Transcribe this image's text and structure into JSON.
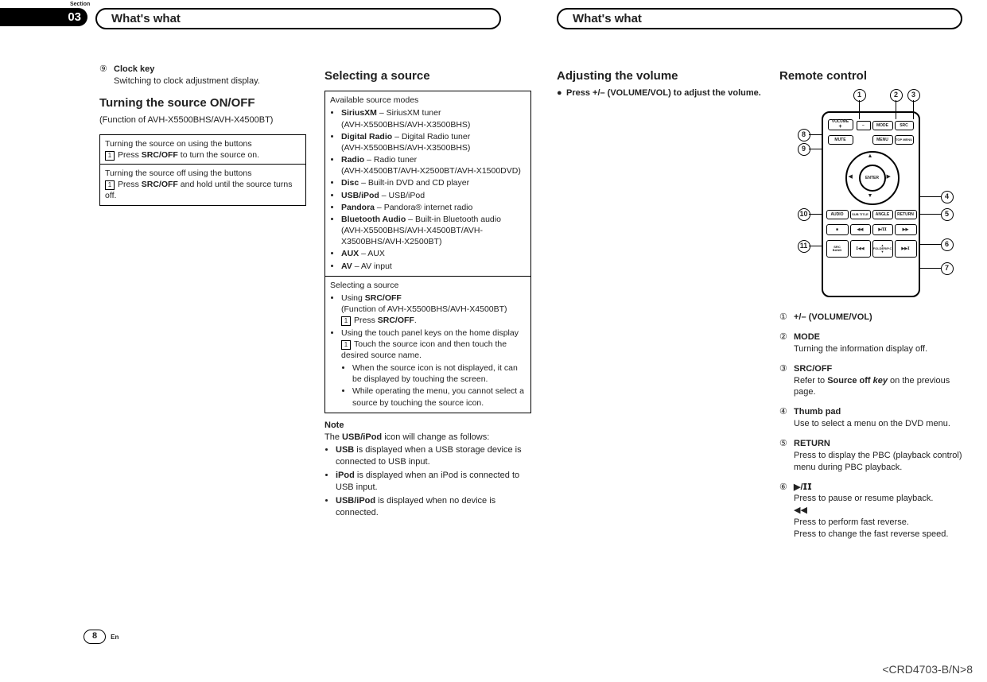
{
  "section": {
    "label": "Section",
    "number": "03"
  },
  "headers": {
    "left": "What's what",
    "right": "What's what"
  },
  "col1": {
    "item9": {
      "num": "⑨",
      "label": "Clock key",
      "desc": "Switching to clock adjustment display."
    },
    "h_turn": "Turning the source ON/OFF",
    "sub_turn": "(Function of AVH-X5500BHS/AVH-X4500BT)",
    "box_on": {
      "title": "Turning the source on using the buttons",
      "step_num": "1",
      "step_pre": "Press ",
      "step_bold": "SRC/OFF",
      "step_post": " to turn the source on."
    },
    "box_off": {
      "title": "Turning the source off using the buttons",
      "step_num": "1",
      "step_pre": "Press ",
      "step_bold": "SRC/OFF",
      "step_post": " and hold until the source turns off."
    }
  },
  "col2": {
    "h_select": "Selecting a source",
    "box_available": {
      "title": "Available source modes",
      "items": [
        {
          "name": "SiriusXM",
          "desc": " – SiriusXM tuner",
          "sub": "(AVH-X5500BHS/AVH-X3500BHS)"
        },
        {
          "name": "Digital Radio",
          "desc": " – Digital Radio tuner",
          "sub": "(AVH-X5500BHS/AVH-X3500BHS)"
        },
        {
          "name": "Radio",
          "desc": " – Radio tuner",
          "sub": "(AVH-X4500BT/AVH-X2500BT/AVH-X1500DVD)"
        },
        {
          "name": "Disc",
          "desc": " – Built-in DVD and CD player"
        },
        {
          "name": "USB/iPod",
          "desc": " – USB/iPod"
        },
        {
          "name": "Pandora",
          "desc": " – Pandora® internet radio"
        },
        {
          "name": "Bluetooth Audio",
          "desc": " – Built-in Bluetooth audio",
          "sub": "(AVH-X5500BHS/AVH-X4500BT/AVH-X3500BHS/AVH-X2500BT)"
        },
        {
          "name": "AUX",
          "desc": " – AUX"
        },
        {
          "name": "AV",
          "desc": " – AV input"
        }
      ]
    },
    "box_select": {
      "title": "Selecting a source",
      "using_src": {
        "label_pre": "Using ",
        "label_bold": "SRC/OFF",
        "sub": "(Function of AVH-X5500BHS/AVH-X4500BT)",
        "step_num": "1",
        "step_pre": "Press ",
        "step_bold": "SRC/OFF",
        "step_post": "."
      },
      "using_touch": {
        "label": "Using the touch panel keys on the home display",
        "step_num": "1",
        "step": "Touch the source icon and then touch the desired source name.",
        "notes": [
          "When the source icon is not displayed, it can be displayed by touching the screen.",
          "While operating the menu, you cannot select a source by touching the source icon."
        ]
      }
    },
    "note": {
      "h": "Note",
      "intro_pre": "The ",
      "intro_bold": "USB/iPod",
      "intro_post": " icon will change as follows:",
      "items": [
        {
          "bold": "USB",
          "post": " is displayed when a USB storage device is connected to USB input."
        },
        {
          "bold": "iPod",
          "post": " is displayed when an iPod is connected to USB input."
        },
        {
          "bold": "USB/iPod",
          "post": " is displayed when no device is connected."
        }
      ]
    }
  },
  "col3": {
    "h_vol": "Adjusting the volume",
    "bullet": "●",
    "vol_text": "Press +/– (VOLUME/VOL) to adjust the volume."
  },
  "col4": {
    "h_remote": "Remote control",
    "callouts": {
      "c1": "1",
      "c2": "2",
      "c3": "3",
      "c4": "4",
      "c5": "5",
      "c6": "6",
      "c7": "7",
      "c8": "8",
      "c9": "9",
      "c10": "10",
      "c11": "11"
    },
    "btns": {
      "volume": "VOLUME",
      "mode": "MODE",
      "src": "SRC",
      "mute": "MUTE",
      "menu": "MENU",
      "topmenu": "TOP MENU",
      "enter": "ENTER",
      "audio": "AUDIO",
      "subtitle": "SUB TITLE",
      "angle": "ANGLE",
      "return": "RETURN",
      "band": "BAND",
      "srcbtn": "SRC",
      "folder": "FOLDER/P.C"
    },
    "items": [
      {
        "num": "①",
        "label": "+/– (VOLUME/VOL)"
      },
      {
        "num": "②",
        "label": "MODE",
        "desc": "Turning the information display off."
      },
      {
        "num": "③",
        "label": "SRC/OFF",
        "desc_pre": "Refer to ",
        "desc_bold": "Source off ",
        "desc_bolditalic": "key",
        "desc_post": " on the previous page."
      },
      {
        "num": "④",
        "label": "Thumb pad",
        "desc": "Use to select a menu on the DVD menu."
      },
      {
        "num": "⑤",
        "label": "RETURN",
        "desc": "Press to display the PBC (playback control) menu during PBC playback."
      },
      {
        "num": "⑥",
        "label": "▶/𝗜𝗜",
        "desc": "Press to pause or resume playback.",
        "extra_sym": "◀◀",
        "extra1": "Press to perform fast reverse.",
        "extra2": "Press to change the fast reverse speed."
      }
    ]
  },
  "footer": {
    "page": "8",
    "lang": "En",
    "code": "<CRD4703-B/N>8"
  }
}
